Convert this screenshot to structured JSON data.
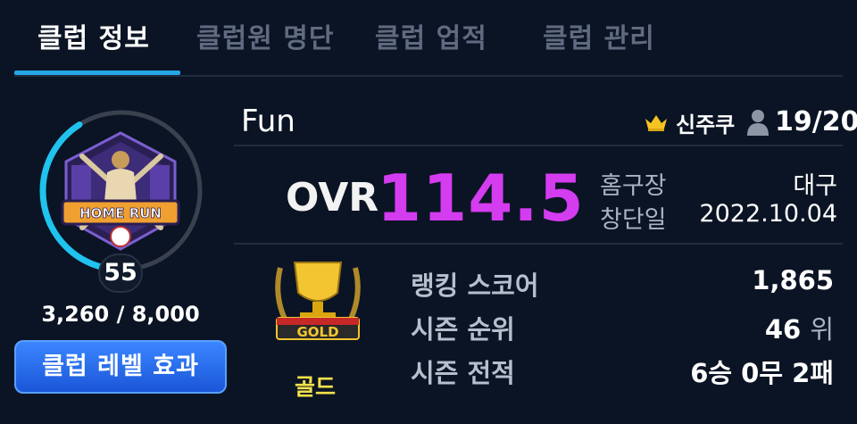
{
  "tabs": [
    {
      "label": "클럽 정보",
      "active": true
    },
    {
      "label": "클럽원 명단",
      "active": false
    },
    {
      "label": "클럽 업적",
      "active": false
    },
    {
      "label": "클럽 관리",
      "active": false
    }
  ],
  "level": {
    "value": "55",
    "xp_text": "3,260 / 8,000",
    "progress_fraction": 0.41,
    "emblem_text": "HOME RUN"
  },
  "level_effect_button": "클럽 레벨 효과",
  "club": {
    "name": "Fun",
    "leader": "신주쿠",
    "members": "19/20"
  },
  "ovr": {
    "label": "OVR",
    "value": "114.5"
  },
  "info": {
    "home_label": "홈구장",
    "home_value": "대구",
    "founded_label": "창단일",
    "founded_value": "2022.10.04"
  },
  "tier": {
    "badge_text": "GOLD",
    "name": "골드"
  },
  "stats": {
    "ranking_label": "랭킹 스코어",
    "ranking_value": "1,865",
    "season_rank_label": "시즌 순위",
    "season_rank_value": "46",
    "season_rank_unit": "위",
    "record_label": "시즌 전적",
    "record_value": "6승 0무 2패"
  },
  "colors": {
    "background": "#0b1424",
    "accent": "#26a6e6",
    "ovr": "#d43cf0",
    "tier": "#f3e24a",
    "button": "#2b6ff0"
  },
  "icons": [
    "crown-icon",
    "person-icon",
    "home-run-emblem",
    "gold-trophy-icon"
  ]
}
